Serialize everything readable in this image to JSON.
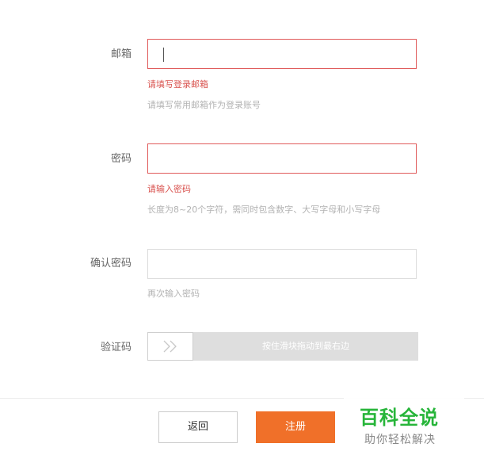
{
  "form": {
    "email": {
      "label": "邮箱",
      "value": "",
      "error": "请填写登录邮箱",
      "hint": "请填写常用邮箱作为登录账号"
    },
    "password": {
      "label": "密码",
      "value": "",
      "error": "请输入密码",
      "hint": "长度为8~20个字符，需同时包含数字、大写字母和小写字母"
    },
    "confirm": {
      "label": "确认密码",
      "value": "",
      "hint": "再次输入密码"
    },
    "captcha": {
      "label": "验证码",
      "slider_text": "按住滑块拖动到最右边",
      "handle_icon": "double-chevron-right-icon"
    }
  },
  "actions": {
    "back_label": "返回",
    "register_label": "注册"
  },
  "watermark": {
    "title": "百科全说",
    "subtitle": "助你轻松解决"
  },
  "colors": {
    "error": "#e05a5a",
    "accent": "#f07029",
    "watermark": "#27b53a"
  }
}
